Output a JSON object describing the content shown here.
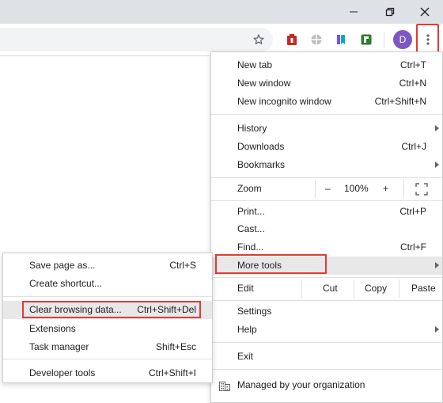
{
  "window": {
    "controls": {
      "minimize_icon": "minimize-icon",
      "restore_icon": "restore-icon",
      "close_icon": "close-icon"
    }
  },
  "toolbar": {
    "bookmark_icon": "star-icon",
    "extensions": [
      "red-extension-icon",
      "gray-globe-extension-icon",
      "bookmark-extension-icon",
      "green-extension-icon"
    ],
    "avatar_letter": "D",
    "menu_icon": "vertical-dots-icon"
  },
  "menu": {
    "new_tab": {
      "label": "New tab",
      "shortcut": "Ctrl+T"
    },
    "new_window": {
      "label": "New window",
      "shortcut": "Ctrl+N"
    },
    "new_incognito": {
      "label": "New incognito window",
      "shortcut": "Ctrl+Shift+N"
    },
    "history": {
      "label": "History"
    },
    "downloads": {
      "label": "Downloads",
      "shortcut": "Ctrl+J"
    },
    "bookmarks": {
      "label": "Bookmarks"
    },
    "zoom": {
      "label": "Zoom",
      "minus": "–",
      "value": "100%",
      "plus": "+"
    },
    "print": {
      "label": "Print...",
      "shortcut": "Ctrl+P"
    },
    "cast": {
      "label": "Cast..."
    },
    "find": {
      "label": "Find...",
      "shortcut": "Ctrl+F"
    },
    "more_tools": {
      "label": "More tools"
    },
    "edit": {
      "label": "Edit",
      "cut": "Cut",
      "copy": "Copy",
      "paste": "Paste"
    },
    "settings": {
      "label": "Settings"
    },
    "help": {
      "label": "Help"
    },
    "exit": {
      "label": "Exit"
    },
    "managed": {
      "label": "Managed by your organization",
      "icon": "building-icon"
    }
  },
  "submenu": {
    "save_page": {
      "label": "Save page as...",
      "shortcut": "Ctrl+S"
    },
    "create_shortcut": {
      "label": "Create shortcut..."
    },
    "clear_browsing": {
      "label": "Clear browsing data...",
      "shortcut": "Ctrl+Shift+Del"
    },
    "extensions": {
      "label": "Extensions"
    },
    "task_manager": {
      "label": "Task manager",
      "shortcut": "Shift+Esc"
    },
    "developer_tools": {
      "label": "Developer tools",
      "shortcut": "Ctrl+Shift+I"
    }
  },
  "colors": {
    "highlight": "#e53935",
    "avatar": "#7e57c2",
    "hover": "#e8e8e8"
  }
}
